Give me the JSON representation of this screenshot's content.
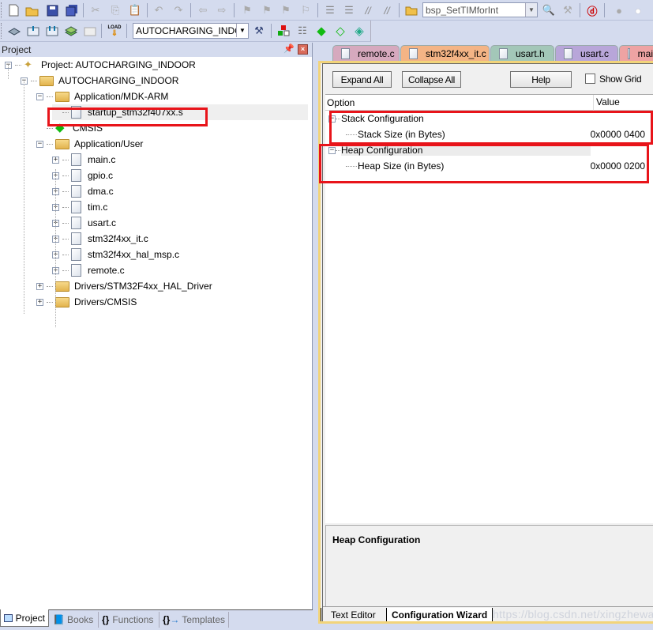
{
  "toolbar1": {
    "icons": [
      "new-file-icon",
      "open-folder-icon",
      "save-icon",
      "save-all-icon",
      "cut-icon",
      "copy-icon",
      "paste-icon",
      "undo-icon",
      "redo-icon",
      "nav-back-icon",
      "nav-forward-icon",
      "bookmark-icon",
      "prev-bookmark-icon",
      "next-bookmark-icon",
      "clear-bookmarks-icon",
      "indent-icon",
      "unindent-icon",
      "comment-icon",
      "uncomment-icon",
      "find-in-files-icon",
      "find-icon",
      "debug-icon",
      "breakpoint-icon",
      "breakpoint-disabled-icon"
    ],
    "find_combo": "bsp_SetTIMforInt"
  },
  "toolbar2": {
    "icons": [
      "translate-icon",
      "build-icon",
      "rebuild-icon",
      "batch-build-icon",
      "stop-build-icon",
      "load-icon",
      "options-icon",
      "manage-components-icon",
      "manage-multi-project-icon",
      "pack-installer-icon",
      "select-software-packs-icon",
      "manage-run-time-icon"
    ],
    "load_label": "LOAD",
    "target_combo": "AUTOCHARGING_INDOO"
  },
  "project_panel": {
    "title": "Project",
    "tree": [
      {
        "label": "Project: AUTOCHARGING_INDOOR",
        "icon": "project-icon",
        "level": 0,
        "toggle": "-"
      },
      {
        "label": "AUTOCHARGING_INDOOR",
        "icon": "target-folder-icon",
        "level": 1,
        "toggle": "-"
      },
      {
        "label": "Application/MDK-ARM",
        "icon": "folder-icon",
        "level": 2,
        "toggle": "-"
      },
      {
        "label": "startup_stm32f407xx.s",
        "icon": "file-icon",
        "level": 3,
        "toggle": "",
        "highlighted": true
      },
      {
        "label": "CMSIS",
        "icon": "component-icon",
        "level": 2,
        "toggle": ""
      },
      {
        "label": "Application/User",
        "icon": "folder-icon",
        "level": 2,
        "toggle": "-"
      },
      {
        "label": "main.c",
        "icon": "file-icon",
        "level": 3,
        "toggle": "+"
      },
      {
        "label": "gpio.c",
        "icon": "file-icon",
        "level": 3,
        "toggle": "+"
      },
      {
        "label": "dma.c",
        "icon": "file-icon",
        "level": 3,
        "toggle": "+"
      },
      {
        "label": "tim.c",
        "icon": "file-icon",
        "level": 3,
        "toggle": "+"
      },
      {
        "label": "usart.c",
        "icon": "file-icon",
        "level": 3,
        "toggle": "+"
      },
      {
        "label": "stm32f4xx_it.c",
        "icon": "file-icon",
        "level": 3,
        "toggle": "+"
      },
      {
        "label": "stm32f4xx_hal_msp.c",
        "icon": "file-icon",
        "level": 3,
        "toggle": "+"
      },
      {
        "label": "remote.c",
        "icon": "file-icon",
        "level": 3,
        "toggle": "+"
      },
      {
        "label": "Drivers/STM32F4xx_HAL_Driver",
        "icon": "folder-icon",
        "level": 2,
        "toggle": "+"
      },
      {
        "label": "Drivers/CMSIS",
        "icon": "folder-icon",
        "level": 2,
        "toggle": "+"
      }
    ],
    "bottom_tabs": [
      {
        "label": "Project",
        "icon": "project-tab-icon",
        "active": true
      },
      {
        "label": "Books",
        "icon": "books-icon",
        "active": false
      },
      {
        "label": "Functions",
        "icon": "functions-icon",
        "active": false
      },
      {
        "label": "Templates",
        "icon": "templates-icon",
        "active": false
      }
    ]
  },
  "file_tabs": [
    {
      "label": "remote.c",
      "color": "#d6a9be"
    },
    {
      "label": "stm32f4xx_it.c",
      "color": "#f4b485"
    },
    {
      "label": "usart.h",
      "color": "#a3c7b8"
    },
    {
      "label": "usart.c",
      "color": "#b8a6d9"
    },
    {
      "label": "main.c",
      "color": "#eea3a3"
    }
  ],
  "wizard": {
    "expand_all": "Expand All",
    "collapse_all": "Collapse All",
    "help": "Help",
    "show_grid": "Show Grid",
    "show_grid_checked": false,
    "col_option": "Option",
    "col_value": "Value",
    "rows": [
      {
        "label": "Stack Configuration",
        "level": 0,
        "toggle": "-",
        "value": ""
      },
      {
        "label": "Stack Size (in Bytes)",
        "level": 1,
        "toggle": "",
        "value": "0x0000 0400"
      },
      {
        "label": "Heap Configuration",
        "level": 0,
        "toggle": "-",
        "value": "",
        "selected": true
      },
      {
        "label": "Heap Size (in Bytes)",
        "level": 1,
        "toggle": "",
        "value": "0x0000 0200"
      }
    ],
    "description_title": "Heap Configuration",
    "view_tabs": [
      {
        "label": "Text Editor",
        "active": false
      },
      {
        "label": "Configuration Wizard",
        "active": true
      }
    ],
    "watermark": "https://blog.csdn.net/xingzhewanfu"
  },
  "highlight_color": "#e8141a"
}
